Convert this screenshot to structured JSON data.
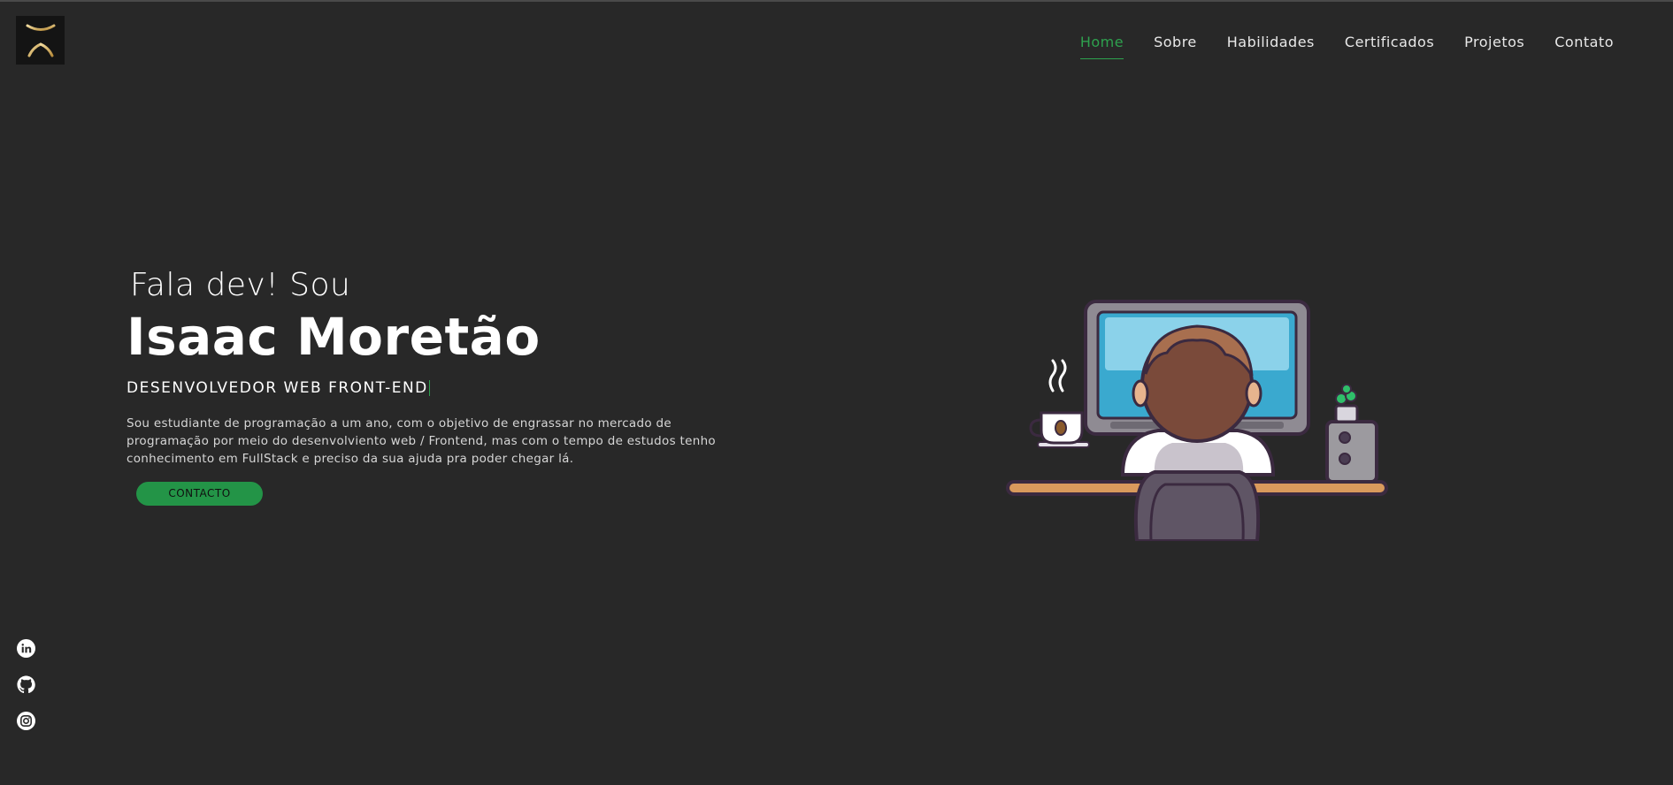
{
  "nav": {
    "items": [
      {
        "label": "Home",
        "active": true
      },
      {
        "label": "Sobre",
        "active": false
      },
      {
        "label": "Habilidades",
        "active": false
      },
      {
        "label": "Certificados",
        "active": false
      },
      {
        "label": "Projetos",
        "active": false
      },
      {
        "label": "Contato",
        "active": false
      }
    ]
  },
  "logo": {
    "icon": "monogram-logo-icon"
  },
  "hero": {
    "greeting": "Fala dev! Sou",
    "name": "Isaac Moretão",
    "role": "DESENVOLVEDOR WEB FRONT-END",
    "description": "Sou estudiante de programação a um ano, com o objetivo de engrassar no mercado de programação por meio do desenvolviento web / Frontend, mas com o tempo de estudos tenho conhecimento em FullStack e preciso da sua ajuda pra poder chegar lá.",
    "cta_label": "CONTACTO"
  },
  "social": {
    "icons": [
      "linkedin-icon",
      "github-icon",
      "instagram-icon"
    ]
  },
  "colors": {
    "background": "#282828",
    "accent": "#2ea14e",
    "button": "#239447",
    "logo_gold": "#d9b872"
  }
}
